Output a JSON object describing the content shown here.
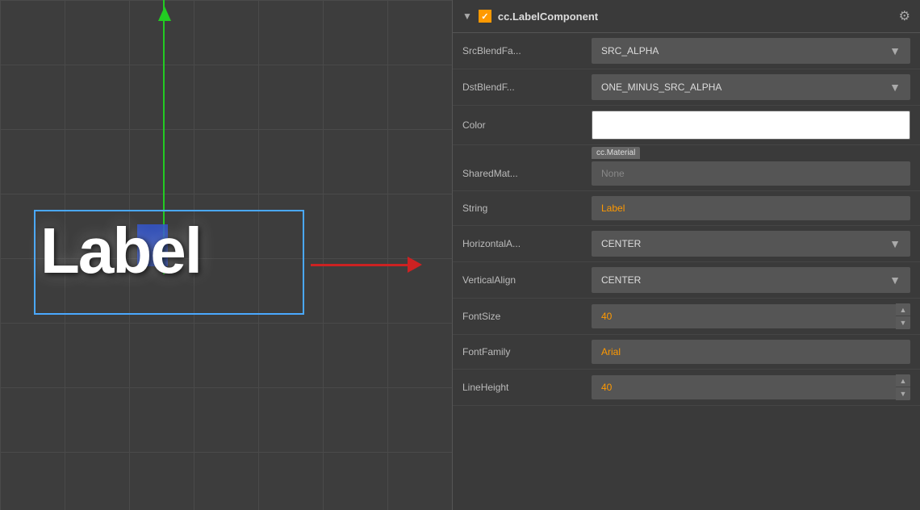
{
  "canvas": {
    "label_text": "Label"
  },
  "component": {
    "collapse_symbol": "▼",
    "title": "cc.LabelComponent",
    "gear_symbol": "⚙"
  },
  "properties": {
    "src_blend_label": "SrcBlendFa...",
    "src_blend_value": "SRC_ALPHA",
    "dst_blend_label": "DstBlendF...",
    "dst_blend_value": "ONE_MINUS_SRC_ALPHA",
    "color_label": "Color",
    "shared_mat_label": "SharedMat...",
    "shared_mat_tag": "cc.Material",
    "shared_mat_value": "None",
    "string_label": "String",
    "string_value": "Label",
    "horiz_align_label": "HorizontalA...",
    "horiz_align_value": "CENTER",
    "vert_align_label": "VerticalAlign",
    "vert_align_value": "CENTER",
    "font_size_label": "FontSize",
    "font_size_value": "40",
    "font_family_label": "FontFamily",
    "font_family_value": "Arial",
    "line_height_label": "LineHeight",
    "line_height_value": "40"
  },
  "icons": {
    "dropdown_arrow": "▼",
    "spinner_up": "▲",
    "spinner_down": "▼"
  }
}
